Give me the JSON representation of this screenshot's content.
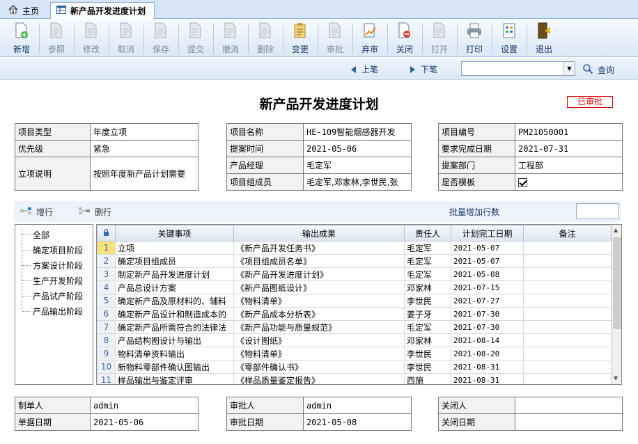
{
  "tabs": {
    "home": "主页",
    "active": "新产品开发进度计划"
  },
  "toolbar": [
    {
      "label": "新增",
      "icon": "new-doc-icon",
      "enabled": true
    },
    {
      "label": "参照",
      "icon": "reference-icon",
      "enabled": false
    },
    {
      "label": "修改",
      "icon": "edit-icon",
      "enabled": false
    },
    {
      "label": "取消",
      "icon": "undo-icon",
      "enabled": false
    },
    {
      "label": "保存",
      "icon": "save-icon",
      "enabled": false
    },
    {
      "label": "提交",
      "icon": "submit-icon",
      "enabled": false
    },
    {
      "label": "撤消",
      "icon": "revoke-icon",
      "enabled": false
    },
    {
      "label": "删除",
      "icon": "delete-icon",
      "enabled": false
    },
    {
      "label": "变更",
      "icon": "change-icon",
      "enabled": true
    },
    {
      "label": "审批",
      "icon": "approve-icon",
      "enabled": false
    },
    {
      "label": "弃审",
      "icon": "unapprove-icon",
      "enabled": true
    },
    {
      "label": "关闭",
      "icon": "close-doc-icon",
      "enabled": true
    },
    {
      "label": "打开",
      "icon": "open-doc-icon",
      "enabled": false
    },
    {
      "label": "打印",
      "icon": "print-icon",
      "enabled": true
    },
    {
      "label": "设置",
      "icon": "settings-icon",
      "enabled": true
    },
    {
      "label": "退出",
      "icon": "exit-icon",
      "enabled": true
    }
  ],
  "nav": {
    "prev": "上笔",
    "next": "下笔",
    "select_value": "",
    "query": "查询"
  },
  "title": "新产品开发进度计划",
  "status": "已审批",
  "left_info": {
    "type_label": "项目类型",
    "type_value": "年度立项",
    "priority_label": "优先级",
    "priority_value": "紧急",
    "desc_label": "立项说明",
    "desc_value": "按照年度新产品计划需要"
  },
  "mid_info": {
    "name_label": "项目名称",
    "name_value": "HE-109智能烟感器开发",
    "date_label": "提案时间",
    "date_value": "2021-05-06",
    "manager_label": "产品经理",
    "manager_value": "毛定军",
    "members_label": "项目组成员",
    "members_value": "毛定军,邓家林,李世民,张"
  },
  "right_info": {
    "code_label": "项目编号",
    "code_value": "PM21050001",
    "due_label": "要求完成日期",
    "due_value": "2021-07-31",
    "dept_label": "提案部门",
    "dept_value": "工程部",
    "template_label": "是否模板"
  },
  "rowbar": {
    "add": "增行",
    "delete": "删行",
    "batch": "批量增加行数",
    "batch_value": ""
  },
  "tree": [
    "全部",
    "确定项目阶段",
    "方案设计阶段",
    "生产开发阶段",
    "产品试产阶段",
    "产品输出阶段"
  ],
  "grid": {
    "headers": [
      "关键事项",
      "输出成果",
      "责任人",
      "计划完工日期",
      "备注"
    ],
    "rows": [
      {
        "no": "1",
        "item": "立项",
        "output": "《新产品开发任务书》",
        "owner": "毛定军",
        "date": "2021-05-07",
        "note": ""
      },
      {
        "no": "2",
        "item": "确定项目组成员",
        "output": "《项目组成员名单》",
        "owner": "毛定军",
        "date": "2021-05-07",
        "note": ""
      },
      {
        "no": "3",
        "item": "制定新产品开发进度计划",
        "output": "《新产品开发进度计划》",
        "owner": "毛定军",
        "date": "2021-05-08",
        "note": ""
      },
      {
        "no": "4",
        "item": "产品总设计方案",
        "output": "《新产品图纸设计》",
        "owner": "邓家林",
        "date": "2021-07-15",
        "note": ""
      },
      {
        "no": "5",
        "item": "确定新产品及原材料的、辅料",
        "output": "《物料清单》",
        "owner": "李世民",
        "date": "2021-07-27",
        "note": ""
      },
      {
        "no": "6",
        "item": "确定新产品设计和制造成本的",
        "output": "《新产品成本分析表》",
        "owner": "姜子牙",
        "date": "2021-07-30",
        "note": ""
      },
      {
        "no": "7",
        "item": "确定新产品所需符合的法律法",
        "output": "《新产品功能与质量规范》",
        "owner": "毛定军",
        "date": "2021-07-30",
        "note": ""
      },
      {
        "no": "8",
        "item": "产品结构图设计与输出",
        "output": "《设计图纸》",
        "owner": "邓家林",
        "date": "2021-08-14",
        "note": ""
      },
      {
        "no": "9",
        "item": "物料清单资料输出",
        "output": "《物料清单》",
        "owner": "李世民",
        "date": "2021-08-20",
        "note": ""
      },
      {
        "no": "10",
        "item": "新物料零部件确认图输出",
        "output": "《零部件确认书》",
        "owner": "李世民",
        "date": "2021-08-31",
        "note": ""
      },
      {
        "no": "11",
        "item": "样品输出与鉴定评审",
        "output": "《样品质量鉴定报告》",
        "owner": "西施",
        "date": "2021-08-31",
        "note": ""
      }
    ]
  },
  "footer": {
    "creator_label": "制单人",
    "creator_value": "admin",
    "doc_date_label": "单据日期",
    "doc_date_value": "2021-05-06",
    "approver_label": "审批人",
    "approver_value": "admin",
    "approve_date_label": "审批日期",
    "approve_date_value": "2021-05-08",
    "closer_label": "关闭人",
    "closer_value": "",
    "close_date_label": "关闭日期",
    "close_date_value": ""
  }
}
